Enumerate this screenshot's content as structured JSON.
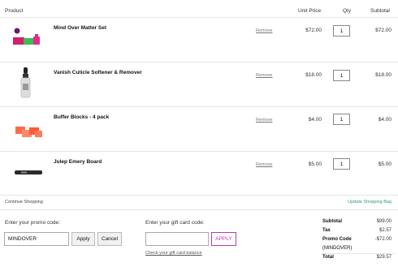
{
  "columns": {
    "product": "Product",
    "unit_price": "Unit Price",
    "qty": "Qty",
    "subtotal": "Subtotal"
  },
  "items": [
    {
      "name": "Mind Over Matter Set",
      "remove": "Remove",
      "unit_price": "$72.00",
      "qty": "1",
      "subtotal": "$72.00",
      "image": "nail-polish-set-image"
    },
    {
      "name": "Vanish Cuticle Softener & Remover",
      "remove": "Remove",
      "unit_price": "$18.00",
      "qty": "1",
      "subtotal": "$18.00",
      "image": "dropper-bottle-image"
    },
    {
      "name": "Buffer Blocks - 4 pack",
      "remove": "Remove",
      "unit_price": "$4.00",
      "qty": "1",
      "subtotal": "$4.00",
      "image": "buffer-blocks-image"
    },
    {
      "name": "Julep Emery Board",
      "remove": "Remove",
      "unit_price": "$5.00",
      "qty": "1",
      "subtotal": "$5.00",
      "image": "emery-board-image"
    }
  ],
  "links": {
    "continue_shopping": "Continue Shopping",
    "update_bag": "Update Shopping Bag",
    "gift_balance": "Check your gift card balance"
  },
  "promo": {
    "label": "Enter your promo code:",
    "value": "MINDOVER",
    "apply": "Apply",
    "cancel": "Cancel"
  },
  "gift": {
    "label": "Enter your gift card code:",
    "value": "",
    "apply": "APPLY"
  },
  "totals": {
    "subtotal_label": "Subtotal",
    "subtotal": "$99.00",
    "tax_label": "Tax",
    "tax": "$2.57",
    "promo_label": "Promo Code",
    "promo": "-$72.00",
    "promo_code": "(MINDOVER)",
    "total_label": "Total",
    "total": "$29.57"
  },
  "colors": {
    "accent_green": "#2a9d6e",
    "gift_apply": "#b83ab5"
  }
}
